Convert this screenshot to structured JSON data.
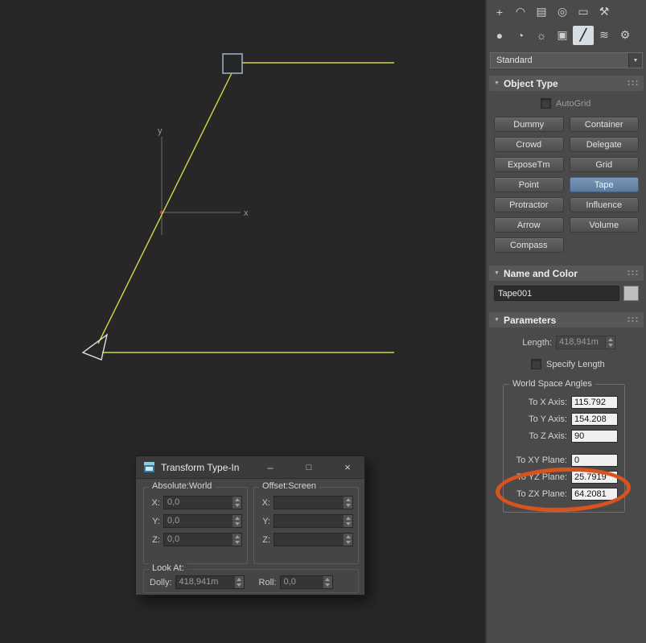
{
  "icons": {
    "rollout_arrow": "▼",
    "dropdown_arrow": "▼"
  },
  "toolbar": {
    "row1": [
      {
        "name": "create",
        "glyph": "+"
      },
      {
        "name": "modify",
        "glyph": "◠"
      },
      {
        "name": "hierarchy",
        "glyph": "▤"
      },
      {
        "name": "motion",
        "glyph": "◎"
      },
      {
        "name": "display",
        "glyph": "▭"
      },
      {
        "name": "utilities",
        "glyph": "⚒"
      }
    ],
    "row2": [
      {
        "name": "geometry",
        "glyph": "●"
      },
      {
        "name": "shapes",
        "glyph": "◔"
      },
      {
        "name": "lights",
        "glyph": "☼"
      },
      {
        "name": "cameras",
        "glyph": "▣"
      },
      {
        "name": "helpers",
        "glyph": "╱"
      },
      {
        "name": "spacewarps",
        "glyph": "≋"
      },
      {
        "name": "systems",
        "glyph": "⚙"
      }
    ]
  },
  "dropdown": {
    "value": "Standard"
  },
  "object_type": {
    "title": "Object Type",
    "autogrid_label": "AutoGrid",
    "buttons": [
      "Dummy",
      "Container",
      "Crowd",
      "Delegate",
      "ExposeTm",
      "Grid",
      "Point",
      "Tape",
      "Protractor",
      "Influence",
      "Arrow",
      "Volume",
      "Compass"
    ],
    "active_button": "Tape",
    "active_color": "#5b7ca1"
  },
  "name_color": {
    "title": "Name and Color",
    "name_value": "Tape001"
  },
  "parameters": {
    "title": "Parameters",
    "length_label": "Length:",
    "length_value": "418,941m",
    "specify_label": "Specify Length",
    "group_title": "World Space Angles",
    "angles": [
      {
        "label": "To X Axis:",
        "value": "115.792"
      },
      {
        "label": "To Y Axis:",
        "value": "154.208"
      },
      {
        "label": "To Z Axis:",
        "value": "90"
      },
      {
        "label": "To XY Plane:",
        "value": "0"
      },
      {
        "label": "To YZ Plane:",
        "value": "25.7919"
      },
      {
        "label": "To ZX Plane:",
        "value": "64.2081"
      }
    ]
  },
  "annotation": {
    "shape": "ellipse",
    "color": "#d9531f",
    "highlights": [
      "To YZ Plane: 25.7919",
      "To ZX Plane: 64.2081"
    ]
  },
  "dialog": {
    "title": "Transform Type-In",
    "controls": {
      "minimize": "–",
      "maximize": "□",
      "close": "×"
    },
    "absolute": {
      "title": "Absolute:World",
      "rows": [
        {
          "label": "X:",
          "value": "0,0"
        },
        {
          "label": "Y:",
          "value": "0,0"
        },
        {
          "label": "Z:",
          "value": "0,0"
        }
      ]
    },
    "offset": {
      "title": "Offset:Screen",
      "rows": [
        {
          "label": "X:",
          "value": ""
        },
        {
          "label": "Y:",
          "value": ""
        },
        {
          "label": "Z:",
          "value": ""
        }
      ]
    },
    "lookat": {
      "title": "Look At:",
      "dolly_label": "Dolly:",
      "dolly_value": "418,941m",
      "roll_label": "Roll:",
      "roll_value": "0,0"
    }
  },
  "viewport": {
    "x_label": "x",
    "y_label": "y",
    "tape_color": "#d6d64a"
  }
}
